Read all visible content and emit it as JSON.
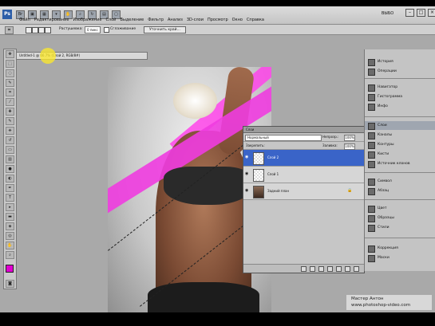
{
  "app": {
    "logo": "Ps",
    "workspace": "ВЫБО",
    "window_buttons": [
      "–",
      "□",
      "×"
    ]
  },
  "menu": {
    "items": [
      "Файл",
      "Редактирование",
      "Изображение",
      "Слой",
      "Выделение",
      "Фильтр",
      "Анализ",
      "3D-слои",
      "Просмотр",
      "Окно",
      "Справка"
    ]
  },
  "options": {
    "feather_label": "Растушевка:",
    "feather_value": "0 пикс",
    "antialias_label": "Сглаживание",
    "refine_button": "Уточнить край..."
  },
  "document": {
    "tab_title": "Untitled-1 @ 66.7% (Слой 2, RGB/8#)"
  },
  "layers_panel": {
    "tab": "Слои",
    "blend_mode": "Нормальный",
    "opacity_label": "Непрозр.:",
    "opacity_value": "100%",
    "lock_label": "Закрепить:",
    "fill_label": "Заливка:",
    "fill_value": "100%",
    "layers": [
      {
        "name": "Слой 2",
        "selected": true
      },
      {
        "name": "Слой 1",
        "selected": false
      },
      {
        "name": "Задний план",
        "selected": false,
        "locked": true
      }
    ]
  },
  "dock": {
    "items": [
      "История",
      "Операции",
      "Навигатор",
      "Гистограмма",
      "Инфо",
      "Слои",
      "Каналы",
      "Контуры",
      "Кисти",
      "Источник клонов",
      "Символ",
      "Абзац",
      "Цвет",
      "Образцы",
      "Стили",
      "Коррекция",
      "Маски"
    ],
    "active": "Слои"
  },
  "watermark": {
    "line1": "Мастер Антон",
    "line2": "www.photoshop-video.com"
  },
  "colors": {
    "foreground": "#e000d0",
    "background": "#ffffff",
    "selection": "#3a64c8"
  }
}
